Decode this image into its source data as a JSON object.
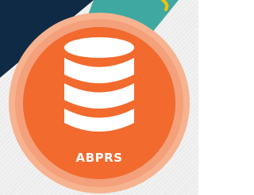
{
  "badge": {
    "label": "ABPRS",
    "icon": "database-icon"
  },
  "colors": {
    "navy": "#0f2a45",
    "teal": "#3fa8a1",
    "yellow": "#f2c200",
    "badge_outer": "#f7b28f",
    "badge_ring": "#f4a07a",
    "badge_fill": "#f26a2e",
    "icon": "#ffffff",
    "background": "#ececec"
  }
}
